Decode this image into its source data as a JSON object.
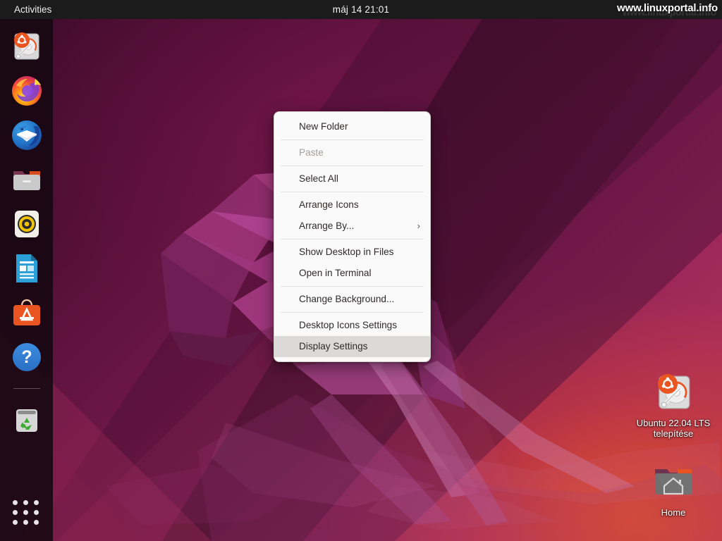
{
  "topbar": {
    "activities_label": "Activities",
    "clock": "máj 14  21:01",
    "watermark": "www.linuxportal.info"
  },
  "dock": {
    "items": [
      {
        "name": "ubuntu-installer",
        "label": "Ubuntu 22.04 LTS telepítése",
        "icon": "disk-ubuntu-icon"
      },
      {
        "name": "firefox",
        "label": "Firefox Web Browser",
        "icon": "firefox-icon"
      },
      {
        "name": "thunderbird",
        "label": "Thunderbird Mail",
        "icon": "thunderbird-icon"
      },
      {
        "name": "files",
        "label": "Files",
        "icon": "folder-icon"
      },
      {
        "name": "rhythmbox",
        "label": "Rhythmbox",
        "icon": "speaker-icon"
      },
      {
        "name": "libreoffice-writer",
        "label": "LibreOffice Writer",
        "icon": "document-icon"
      },
      {
        "name": "ubuntu-software",
        "label": "Ubuntu Software",
        "icon": "software-bag-icon"
      },
      {
        "name": "help",
        "label": "Help",
        "icon": "question-mark-icon"
      },
      {
        "name": "trash",
        "label": "Trash",
        "icon": "trash-recycle-icon"
      }
    ],
    "show_apps_label": "Show Applications"
  },
  "desktop_icons": [
    {
      "name": "install-ubuntu",
      "label": "Ubuntu 22.04 LTS telepítése",
      "icon": "disk-ubuntu-icon"
    },
    {
      "name": "home-folder",
      "label": "Home",
      "icon": "home-folder-icon"
    }
  ],
  "context_menu": {
    "items": [
      {
        "label": "New Folder",
        "disabled": false,
        "selected": false,
        "separator_after": true,
        "submenu": false
      },
      {
        "label": "Paste",
        "disabled": true,
        "selected": false,
        "separator_after": true,
        "submenu": false
      },
      {
        "label": "Select All",
        "disabled": false,
        "selected": false,
        "separator_after": true,
        "submenu": false
      },
      {
        "label": "Arrange Icons",
        "disabled": false,
        "selected": false,
        "separator_after": false,
        "submenu": false
      },
      {
        "label": "Arrange By...",
        "disabled": false,
        "selected": false,
        "separator_after": true,
        "submenu": true
      },
      {
        "label": "Show Desktop in Files",
        "disabled": false,
        "selected": false,
        "separator_after": false,
        "submenu": false
      },
      {
        "label": "Open in Terminal",
        "disabled": false,
        "selected": false,
        "separator_after": true,
        "submenu": false
      },
      {
        "label": "Change Background...",
        "disabled": false,
        "selected": false,
        "separator_after": true,
        "submenu": false
      },
      {
        "label": "Desktop Icons Settings",
        "disabled": false,
        "selected": false,
        "separator_after": false,
        "submenu": false
      },
      {
        "label": "Display Settings",
        "disabled": false,
        "selected": true,
        "separator_after": false,
        "submenu": false
      }
    ],
    "submenu_arrow": "›"
  },
  "colors": {
    "accent_orange": "#e95420",
    "topbar_bg": "#1b1b1b",
    "dock_bg": "#140810",
    "menu_bg": "#fafafa",
    "menu_selected_bg": "#dcdad8",
    "wallpaper_deep_purple": "#3a0a29",
    "wallpaper_magenta": "#8e2057"
  }
}
